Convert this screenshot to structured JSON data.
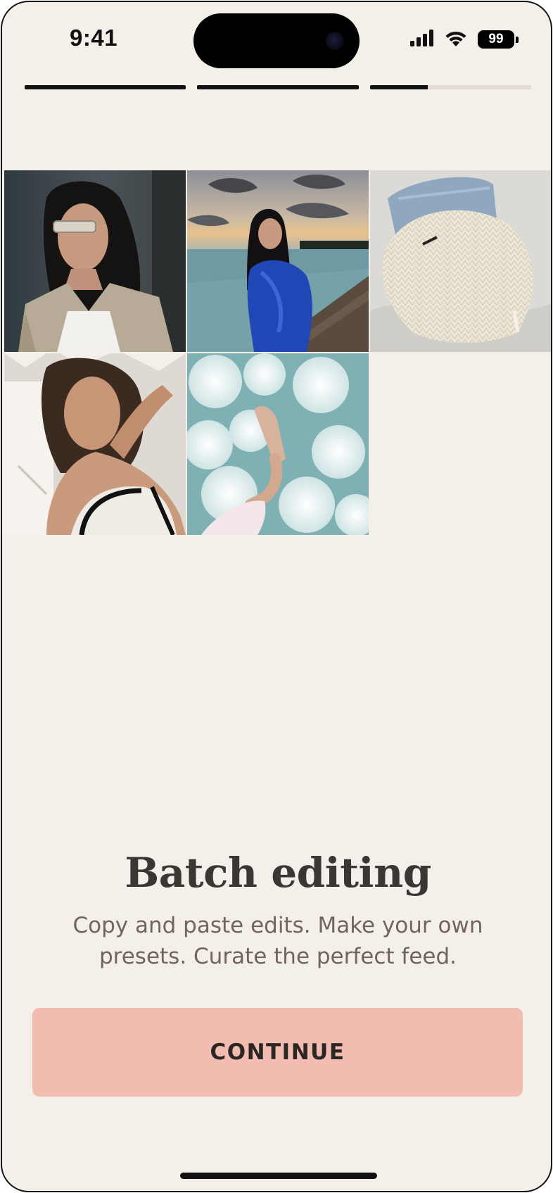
{
  "status_bar": {
    "time": "9:41",
    "battery": "99",
    "icons": [
      "cellular-signal-icon",
      "wifi-icon",
      "battery-icon"
    ]
  },
  "progress": {
    "segments": [
      {
        "fill": 1.0
      },
      {
        "fill": 1.0
      },
      {
        "fill": 0.36
      }
    ]
  },
  "photos": [
    {
      "subject": "woman-in-sunglasses-trench-coat"
    },
    {
      "subject": "woman-in-blue-dress-on-pier"
    },
    {
      "subject": "knit-sweater-and-jeans-flatlay"
    },
    {
      "subject": "woman-posing-in-striped-shade"
    },
    {
      "subject": "hand-over-ocean-waves"
    }
  ],
  "content": {
    "title": "Batch editing",
    "subtitle_line1": "Copy and paste edits. Make your own",
    "subtitle_line2": "presets. Curate the perfect feed."
  },
  "continue_button": {
    "label": "CONTINUE",
    "color": "#f2bdb0"
  },
  "colors": {
    "background": "#f5efea",
    "progress_active": "#111111",
    "progress_inactive": "#e3dbd3",
    "title": "#3a3634",
    "subtitle": "#6e6562"
  }
}
